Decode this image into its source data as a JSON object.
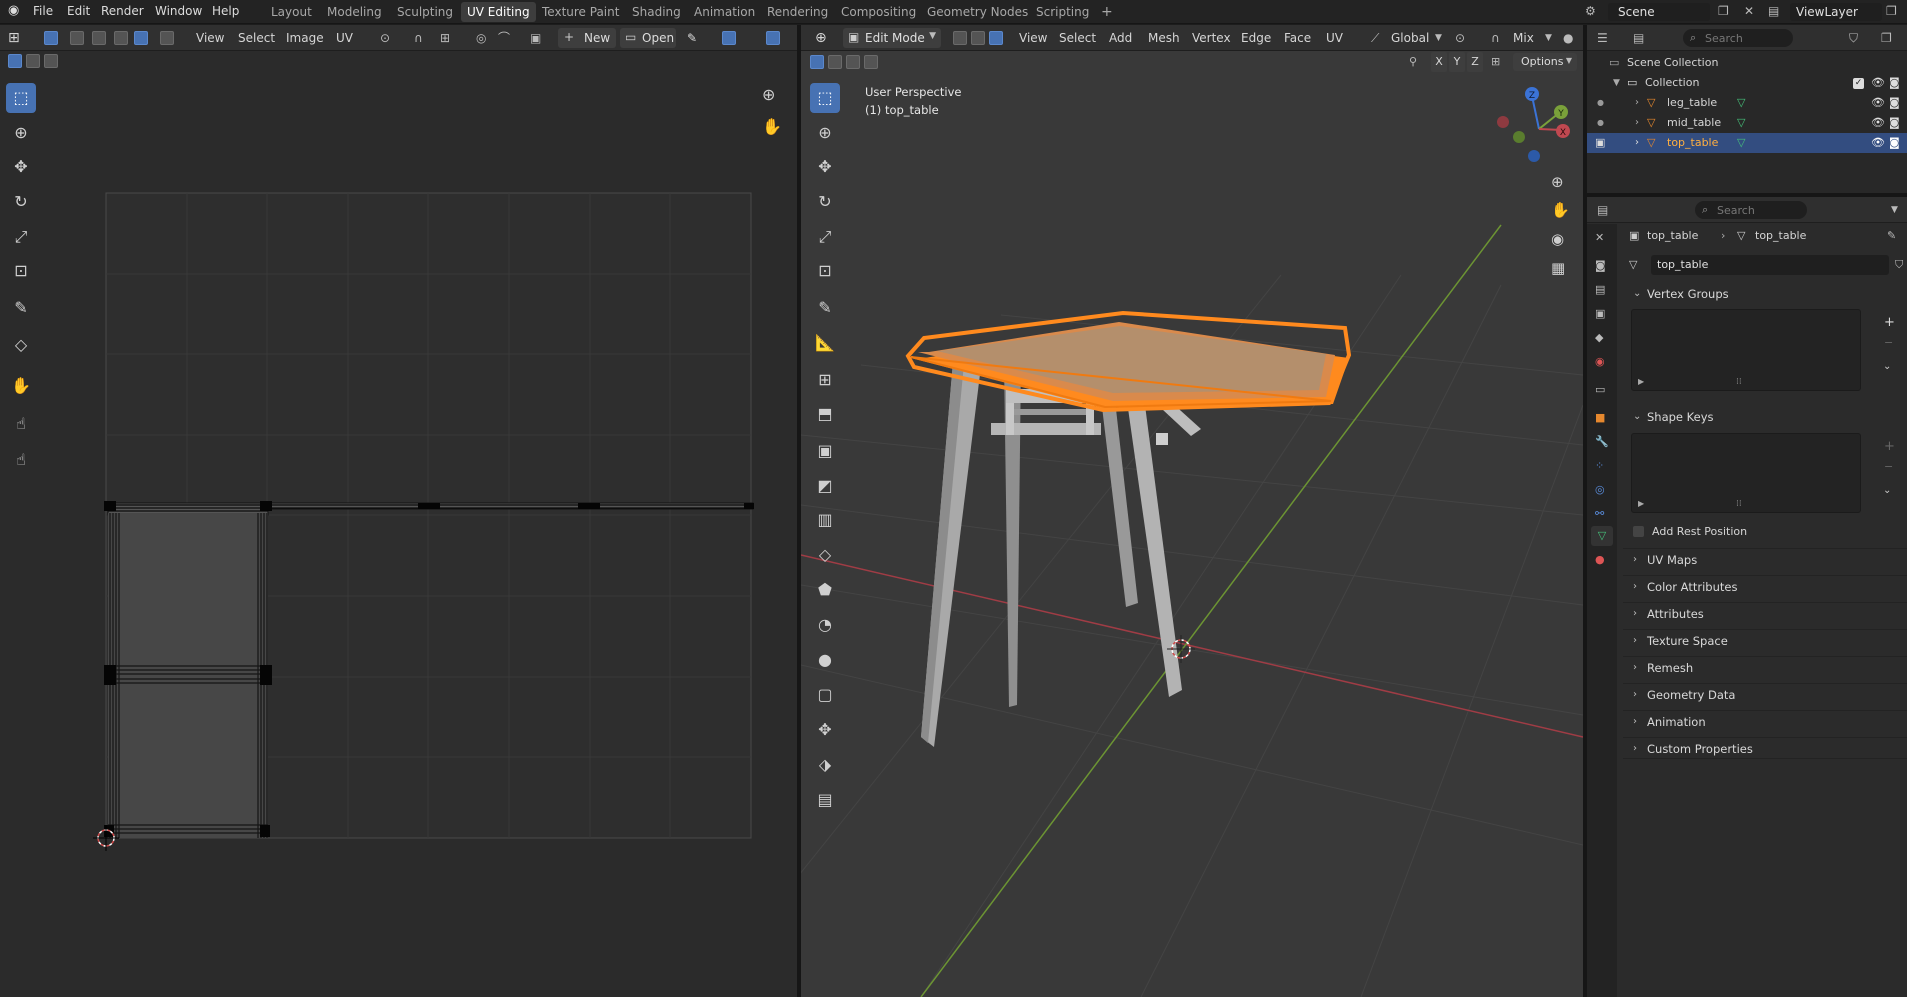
{
  "topbar": {
    "menus": [
      "File",
      "Edit",
      "Render",
      "Window",
      "Help"
    ],
    "workspaces": [
      "Layout",
      "Modeling",
      "Sculpting",
      "UV Editing",
      "Texture Paint",
      "Shading",
      "Animation",
      "Rendering",
      "Compositing",
      "Geometry Nodes",
      "Scripting"
    ],
    "active_workspace": "UV Editing",
    "add_workspace": "+",
    "scene_name": "Scene",
    "viewlayer_name": "ViewLayer"
  },
  "uv_editor": {
    "menus": [
      "View",
      "Select",
      "Image",
      "UV"
    ],
    "new_label": "New",
    "open_label": "Open"
  },
  "viewport": {
    "mode": "Edit Mode",
    "menus": [
      "View",
      "Select",
      "Add",
      "Mesh",
      "Vertex",
      "Edge",
      "Face",
      "UV"
    ],
    "orientation": "Global",
    "shading_mix": "Mix",
    "axes": [
      "X",
      "Y",
      "Z"
    ],
    "options_label": "Options",
    "overlay_title": "User Perspective",
    "overlay_object": "(1) top_table",
    "gizmo_axes": {
      "x": "X",
      "y": "Y",
      "z": "Z"
    },
    "colors": {
      "selection": "#ff8a1e",
      "x_axis": "#c04850",
      "y_axis": "#7aa13a"
    }
  },
  "outliner": {
    "search_placeholder": "Search",
    "scene_collection": "Scene Collection",
    "collection": "Collection",
    "objects": [
      {
        "name": "leg_table",
        "selected": false
      },
      {
        "name": "mid_table",
        "selected": false
      },
      {
        "name": "top_table",
        "selected": true
      }
    ]
  },
  "properties": {
    "search_placeholder": "Search",
    "breadcrumb": {
      "object": "top_table",
      "mesh": "top_table"
    },
    "mesh_name": "top_table",
    "panels": {
      "vertex_groups": "Vertex Groups",
      "shape_keys": "Shape Keys",
      "add_rest_position": "Add Rest Position"
    },
    "collapsed_panels": [
      "UV Maps",
      "Color Attributes",
      "Attributes",
      "Texture Space",
      "Remesh",
      "Geometry Data",
      "Animation",
      "Custom Properties"
    ],
    "tab_icons": [
      "tool-icon",
      "render-icon",
      "output-icon",
      "view-layer-icon",
      "scene-icon",
      "world-icon",
      "collection-icon",
      "object-icon",
      "modifier-icon",
      "particles-icon",
      "physics-icon",
      "constraints-icon",
      "mesh-data-icon",
      "material-icon"
    ]
  }
}
